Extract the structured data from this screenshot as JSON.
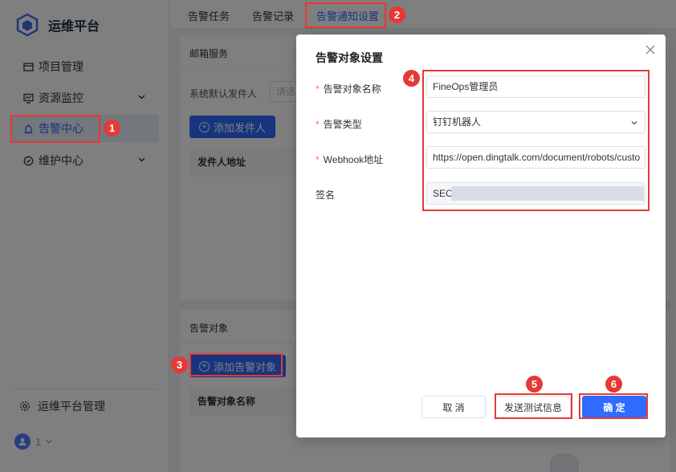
{
  "brand": {
    "title": "运维平台"
  },
  "sidebar": {
    "items": [
      {
        "label": "项目管理",
        "icon": "project-icon"
      },
      {
        "label": "资源监控",
        "icon": "monitor-icon"
      },
      {
        "label": "告警中心",
        "icon": "alarm-icon"
      },
      {
        "label": "维护中心",
        "icon": "maintenance-icon"
      }
    ],
    "footer_label": "运维平台管理",
    "user_label": "1"
  },
  "tabs": [
    "告警任务",
    "告警记录",
    "告警通知设置"
  ],
  "mail_section": {
    "title": "邮箱服务",
    "default_sender_label": "系统默认发件人",
    "default_sender_placeholder": "请选",
    "add_sender_label": "添加发件人",
    "table_header": "发件人地址"
  },
  "target_section": {
    "title": "告警对象",
    "add_target_label": "添加告警对象",
    "table_header": "告警对象名称"
  },
  "modal": {
    "title": "告警对象设置",
    "fields": {
      "name_label": "告警对象名称",
      "name_value": "FineOps管理员",
      "type_label": "告警类型",
      "type_value": "钉钉机器人",
      "webhook_label": "Webhook地址",
      "webhook_value": "https://open.dingtalk.com/document/robots/custo",
      "sign_label": "签名",
      "sign_value": "SEC"
    },
    "buttons": {
      "cancel": "取 消",
      "send_test": "发送测试信息",
      "confirm": "确 定"
    }
  },
  "annotations": [
    "1",
    "2",
    "3",
    "4",
    "5",
    "6"
  ],
  "colors": {
    "accent": "#2f6bff",
    "annotation": "#e53935"
  }
}
